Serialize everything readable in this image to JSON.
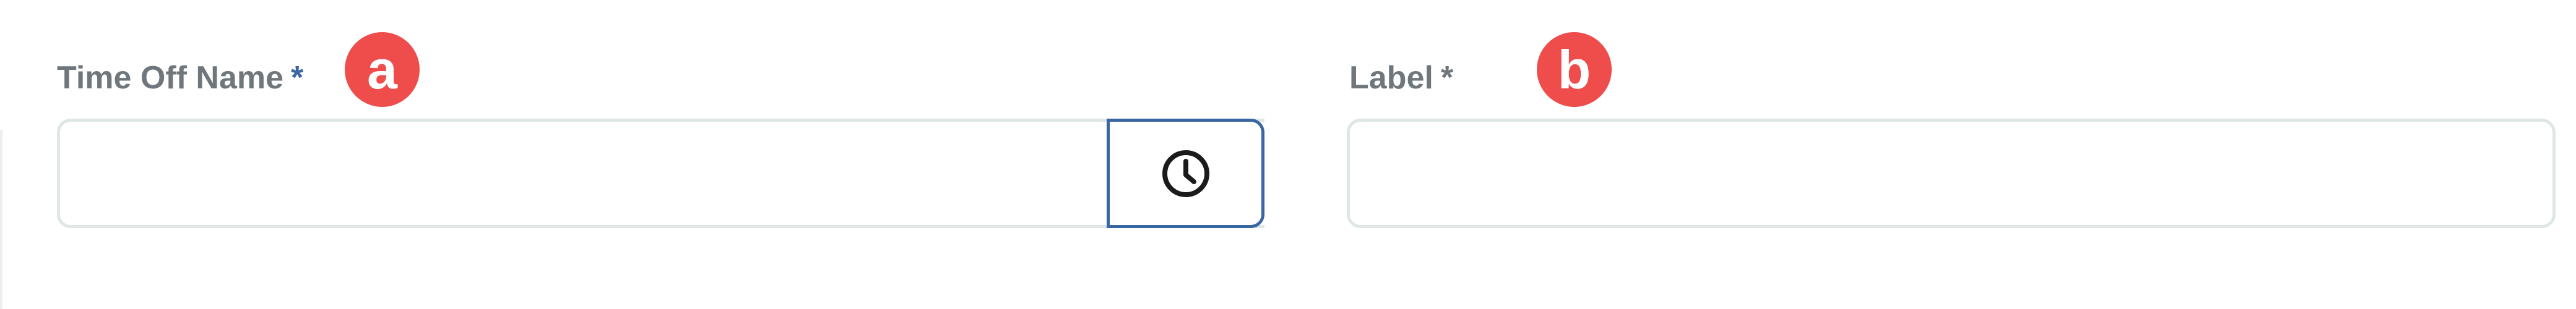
{
  "fields": {
    "time_off_name": {
      "label": "Time Off Name",
      "required_mark": "*",
      "annotation": "a",
      "value": ""
    },
    "label": {
      "label": "Label",
      "required_mark": "*",
      "annotation": "b",
      "value": ""
    }
  },
  "time_button": {
    "icon": "clock-icon"
  },
  "colors": {
    "label_text": "#6f767c",
    "required_blue": "#3a66a3",
    "badge": "#ef4c4c",
    "input_border": "#dfe6e6",
    "focus_border": "#3a66a3"
  }
}
